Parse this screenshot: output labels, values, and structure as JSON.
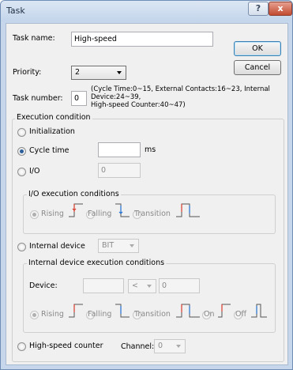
{
  "window": {
    "title": "Task",
    "help_glyph": "?",
    "close_glyph": "x"
  },
  "task_name": {
    "label": "Task name:",
    "value": "High-speed"
  },
  "priority": {
    "label": "Priority:",
    "value": "2"
  },
  "task_number": {
    "label": "Task number:",
    "value": "0",
    "note_line1": "(Cycle Time:0~15, External Contacts:16~23, Internal",
    "note_line2": "Device:24~39,",
    "note_line3": "High-speed Counter:40~47)"
  },
  "buttons": {
    "ok": "OK",
    "cancel": "Cancel"
  },
  "execution": {
    "title": "Execution condition",
    "initialization": "Initialization",
    "cycle_time": {
      "label": "Cycle time",
      "value": "",
      "unit": "ms"
    },
    "io": {
      "label": "I/O",
      "value": "0"
    },
    "io_conditions": {
      "title": "I/O execution conditions",
      "rising": "Rising",
      "falling": "Falling",
      "transition": "Transition"
    },
    "internal_device": {
      "label": "Internal device",
      "type": "BIT"
    },
    "internal_conditions": {
      "title": "Internal device execution conditions",
      "device_label": "Device:",
      "device_value": "",
      "operator": "<",
      "compare_value": "0",
      "rising": "Rising",
      "falling": "Falling",
      "transition": "Transition",
      "on": "On",
      "off": "Off"
    },
    "high_speed_counter": {
      "label": "High-speed counter",
      "channel_label": "Channel:",
      "channel_value": "0"
    }
  },
  "colors": {
    "rising_edge": "#d83a2a",
    "falling_edge": "#1f6fd0",
    "signal": "#555555"
  }
}
